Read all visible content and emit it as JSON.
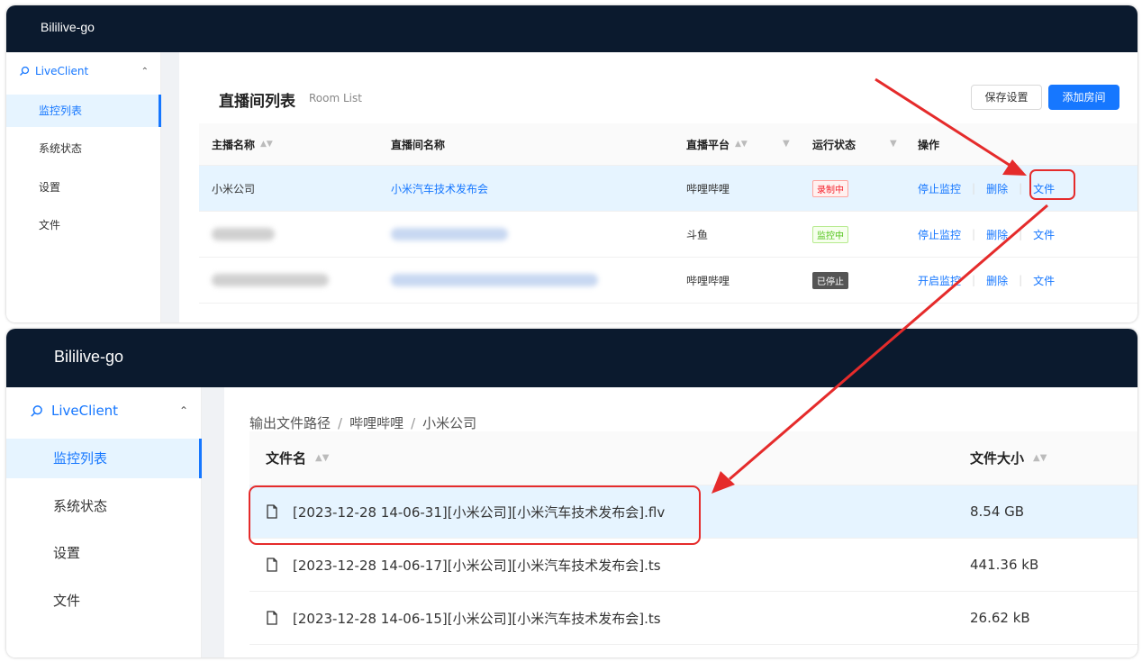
{
  "top_window": {
    "brand": "Bililive-go",
    "sidebar": {
      "group": "LiveClient",
      "items": [
        {
          "label": "监控列表",
          "active": true
        },
        {
          "label": "系统状态",
          "active": false
        },
        {
          "label": "设置",
          "active": false
        },
        {
          "label": "文件",
          "active": false
        }
      ]
    },
    "page_title": "直播间列表",
    "page_subtitle": "Room List",
    "buttons": {
      "save": "保存设置",
      "add": "添加房间"
    },
    "table": {
      "headers": {
        "anchor": "主播名称",
        "room": "直播间名称",
        "platform": "直播平台",
        "status": "运行状态",
        "ops": "操作"
      },
      "rows": [
        {
          "anchor": "小米公司",
          "room": "小米汽车技术发布会",
          "platform": "哔哩哔哩",
          "status": "录制中",
          "op_toggle": "停止监控",
          "op_delete": "删除",
          "op_file": "文件"
        },
        {
          "anchor": "",
          "room": "",
          "platform": "斗鱼",
          "status": "监控中",
          "op_toggle": "停止监控",
          "op_delete": "删除",
          "op_file": "文件"
        },
        {
          "anchor": "",
          "room": "",
          "platform": "哔哩哔哩",
          "status": "已停止",
          "op_toggle": "开启监控",
          "op_delete": "删除",
          "op_file": "文件"
        }
      ]
    }
  },
  "bottom_window": {
    "brand": "Bililive-go",
    "sidebar": {
      "group": "LiveClient",
      "items": [
        {
          "label": "监控列表",
          "active": true
        },
        {
          "label": "系统状态",
          "active": false
        },
        {
          "label": "设置",
          "active": false
        },
        {
          "label": "文件",
          "active": false
        }
      ]
    },
    "breadcrumb": [
      "输出文件路径",
      "哔哩哔哩",
      "小米公司"
    ],
    "table": {
      "headers": {
        "name": "文件名",
        "size": "文件大小"
      },
      "rows": [
        {
          "name": "[2023-12-28 14-06-31][小米公司][小米汽车技术发布会].flv",
          "size": "8.54 GB"
        },
        {
          "name": "[2023-12-28 14-06-17][小米公司][小米汽车技术发布会].ts",
          "size": "441.36 kB"
        },
        {
          "name": "[2023-12-28 14-06-15][小米公司][小米汽车技术发布会].ts",
          "size": "26.62 kB"
        }
      ]
    }
  },
  "colors": {
    "accent": "#1677ff",
    "header_bg": "#0b1a2e",
    "annotation": "#e52b2b"
  }
}
